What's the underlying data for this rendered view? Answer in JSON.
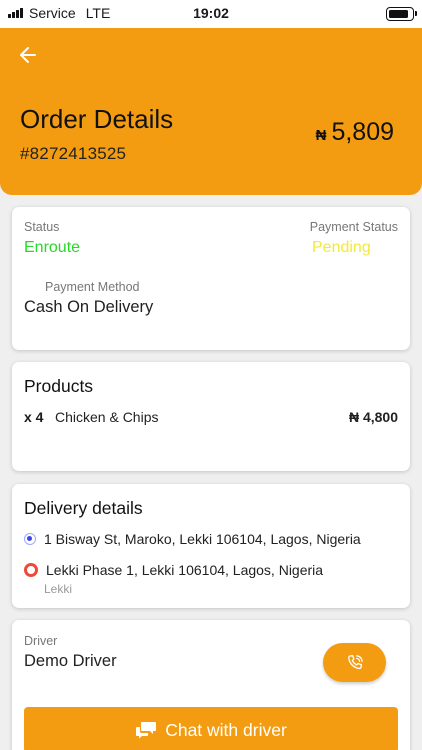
{
  "status_bar": {
    "carrier": "Service",
    "network": "LTE",
    "time": "19:02"
  },
  "header": {
    "title": "Order Details",
    "order_number": "#8272413525",
    "currency_symbol": "₦",
    "total": "5,809",
    "background_color": "#f39c12",
    "back_icon": "arrow-left-icon"
  },
  "status_card": {
    "status_label": "Status",
    "status_value": "Enroute",
    "status_color": "#2ad82a",
    "payment_status_label": "Payment Status",
    "payment_status_value": "Pending",
    "payment_status_color": "#f2ea3a",
    "payment_method_label": "Payment Method",
    "payment_method_value": "Cash On Delivery"
  },
  "products": {
    "title": "Products",
    "items": [
      {
        "qty": "x 4",
        "name": "Chicken & Chips",
        "price": "₦ 4,800"
      }
    ]
  },
  "delivery": {
    "title": "Delivery details",
    "pickup_address": "1 Bisway St, Maroko, Lekki 106104, Lagos, Nigeria",
    "dropoff_address": "Lekki Phase 1, Lekki 106104, Lagos, Nigeria",
    "dropoff_area": "Lekki"
  },
  "driver": {
    "label": "Driver",
    "name": "Demo Driver",
    "call_icon": "phone-icon",
    "chat_label": "Chat with driver",
    "chat_icon": "chat-icon"
  }
}
